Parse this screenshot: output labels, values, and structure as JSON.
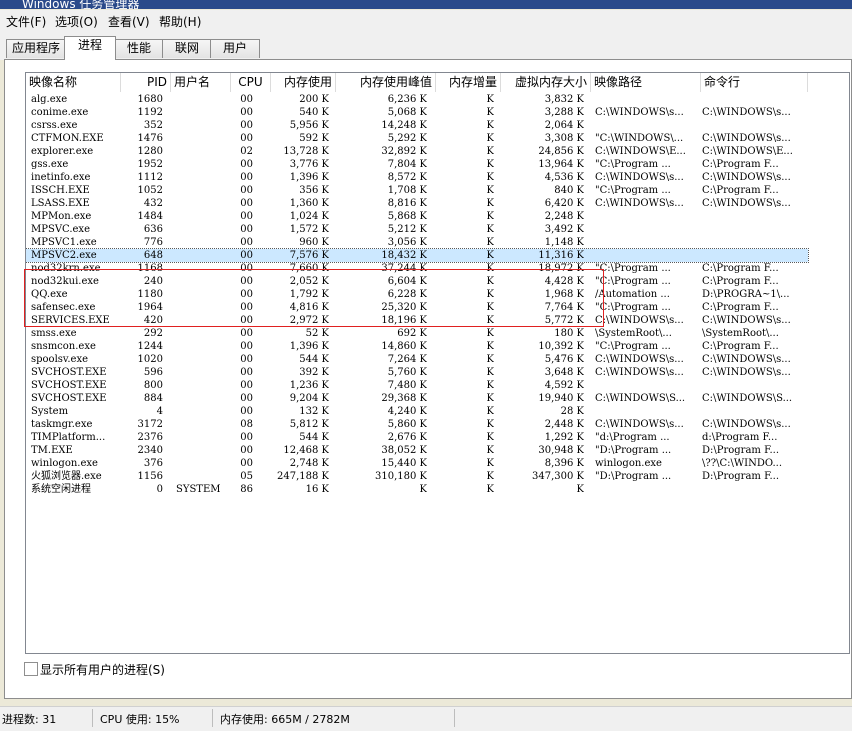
{
  "window": {
    "title": "Windows 任务管理器"
  },
  "menu": [
    {
      "label": "文件(F)"
    },
    {
      "label": "选项(O)"
    },
    {
      "label": "查看(V)"
    },
    {
      "label": "帮助(H)"
    }
  ],
  "tabs": [
    {
      "label": "应用程序",
      "active": false
    },
    {
      "label": "进程",
      "active": true
    },
    {
      "label": "性能",
      "active": false
    },
    {
      "label": "联网",
      "active": false
    },
    {
      "label": "用户",
      "active": false
    }
  ],
  "columns": [
    {
      "key": "name",
      "label": "映像名称"
    },
    {
      "key": "pid",
      "label": "PID"
    },
    {
      "key": "user",
      "label": "用户名"
    },
    {
      "key": "cpu",
      "label": "CPU"
    },
    {
      "key": "mem",
      "label": "内存使用"
    },
    {
      "key": "peak",
      "label": "内存使用峰值"
    },
    {
      "key": "delta",
      "label": "内存增量"
    },
    {
      "key": "vm",
      "label": "虚拟内存大小"
    },
    {
      "key": "path",
      "label": "映像路径"
    },
    {
      "key": "cmd",
      "label": "命令行"
    }
  ],
  "processes": [
    {
      "name": "alg.exe",
      "pid": "1680",
      "user": "",
      "cpu": "00",
      "mem": "200 K",
      "peak": "6,236 K",
      "delta": "K",
      "vm": "3,832 K",
      "path": "",
      "cmd": ""
    },
    {
      "name": "conime.exe",
      "pid": "1192",
      "user": "",
      "cpu": "00",
      "mem": "540 K",
      "peak": "5,068 K",
      "delta": "K",
      "vm": "3,288 K",
      "path": "C:\\WINDOWS\\s...",
      "cmd": "C:\\WINDOWS\\s..."
    },
    {
      "name": "csrss.exe",
      "pid": "352",
      "user": "",
      "cpu": "00",
      "mem": "5,956 K",
      "peak": "14,248 K",
      "delta": "K",
      "vm": "2,064 K",
      "path": "",
      "cmd": ""
    },
    {
      "name": "CTFMON.EXE",
      "pid": "1476",
      "user": "",
      "cpu": "00",
      "mem": "592 K",
      "peak": "5,292 K",
      "delta": "K",
      "vm": "3,308 K",
      "path": "\"C:\\WINDOWS\\...",
      "cmd": "C:\\WINDOWS\\s..."
    },
    {
      "name": "explorer.exe",
      "pid": "1280",
      "user": "",
      "cpu": "02",
      "mem": "13,728 K",
      "peak": "32,892 K",
      "delta": "K",
      "vm": "24,856 K",
      "path": "C:\\WINDOWS\\E...",
      "cmd": "C:\\WINDOWS\\E..."
    },
    {
      "name": "gss.exe",
      "pid": "1952",
      "user": "",
      "cpu": "00",
      "mem": "3,776 K",
      "peak": "7,804 K",
      "delta": "K",
      "vm": "13,964 K",
      "path": "\"C:\\Program ...",
      "cmd": "C:\\Program F..."
    },
    {
      "name": "inetinfo.exe",
      "pid": "1112",
      "user": "",
      "cpu": "00",
      "mem": "1,396 K",
      "peak": "8,572 K",
      "delta": "K",
      "vm": "4,536 K",
      "path": "C:\\WINDOWS\\s...",
      "cmd": "C:\\WINDOWS\\s..."
    },
    {
      "name": "ISSCH.EXE",
      "pid": "1052",
      "user": "",
      "cpu": "00",
      "mem": "356 K",
      "peak": "1,708 K",
      "delta": "K",
      "vm": "840 K",
      "path": "\"C:\\Program ...",
      "cmd": "C:\\Program F..."
    },
    {
      "name": "LSASS.EXE",
      "pid": "432",
      "user": "",
      "cpu": "00",
      "mem": "1,360 K",
      "peak": "8,816 K",
      "delta": "K",
      "vm": "6,420 K",
      "path": "C:\\WINDOWS\\s...",
      "cmd": "C:\\WINDOWS\\s..."
    },
    {
      "name": "MPMon.exe",
      "pid": "1484",
      "user": "",
      "cpu": "00",
      "mem": "1,024 K",
      "peak": "5,868 K",
      "delta": "K",
      "vm": "2,248 K",
      "path": "",
      "cmd": ""
    },
    {
      "name": "MPSVC.exe",
      "pid": "636",
      "user": "",
      "cpu": "00",
      "mem": "1,572 K",
      "peak": "5,212 K",
      "delta": "K",
      "vm": "3,492 K",
      "path": "",
      "cmd": ""
    },
    {
      "name": "MPSVC1.exe",
      "pid": "776",
      "user": "",
      "cpu": "00",
      "mem": "960 K",
      "peak": "3,056 K",
      "delta": "K",
      "vm": "1,148 K",
      "path": "",
      "cmd": ""
    },
    {
      "name": "MPSVC2.exe",
      "pid": "648",
      "user": "",
      "cpu": "00",
      "mem": "7,576 K",
      "peak": "18,432 K",
      "delta": "K",
      "vm": "11,316 K",
      "path": "",
      "cmd": "",
      "selected": true
    },
    {
      "name": "nod32krn.exe",
      "pid": "1168",
      "user": "",
      "cpu": "00",
      "mem": "7,660 K",
      "peak": "37,244 K",
      "delta": "K",
      "vm": "18,972 K",
      "path": "\"C:\\Program ...",
      "cmd": "C:\\Program F..."
    },
    {
      "name": "nod32kui.exe",
      "pid": "240",
      "user": "",
      "cpu": "00",
      "mem": "2,052 K",
      "peak": "6,604 K",
      "delta": "K",
      "vm": "4,428 K",
      "path": "\"C:\\Program ...",
      "cmd": "C:\\Program F..."
    },
    {
      "name": "QQ.exe",
      "pid": "1180",
      "user": "",
      "cpu": "00",
      "mem": "1,792 K",
      "peak": "6,228 K",
      "delta": "K",
      "vm": "1,968 K",
      "path": "/Automation ...",
      "cmd": "D:\\PROGRA~1\\..."
    },
    {
      "name": "safensec.exe",
      "pid": "1964",
      "user": "",
      "cpu": "00",
      "mem": "4,816 K",
      "peak": "25,320 K",
      "delta": "K",
      "vm": "7,764 K",
      "path": "\"C:\\Program ...",
      "cmd": "C:\\Program F..."
    },
    {
      "name": "SERVICES.EXE",
      "pid": "420",
      "user": "",
      "cpu": "00",
      "mem": "2,972 K",
      "peak": "18,196 K",
      "delta": "K",
      "vm": "5,772 K",
      "path": "C:\\WINDOWS\\s...",
      "cmd": "C:\\WINDOWS\\s..."
    },
    {
      "name": "smss.exe",
      "pid": "292",
      "user": "",
      "cpu": "00",
      "mem": "52 K",
      "peak": "692 K",
      "delta": "K",
      "vm": "180 K",
      "path": "\\SystemRoot\\...",
      "cmd": "\\SystemRoot\\..."
    },
    {
      "name": "snsmcon.exe",
      "pid": "1244",
      "user": "",
      "cpu": "00",
      "mem": "1,396 K",
      "peak": "14,860 K",
      "delta": "K",
      "vm": "10,392 K",
      "path": "\"C:\\Program ...",
      "cmd": "C:\\Program F..."
    },
    {
      "name": "spoolsv.exe",
      "pid": "1020",
      "user": "",
      "cpu": "00",
      "mem": "544 K",
      "peak": "7,264 K",
      "delta": "K",
      "vm": "5,476 K",
      "path": "C:\\WINDOWS\\s...",
      "cmd": "C:\\WINDOWS\\s..."
    },
    {
      "name": "SVCHOST.EXE",
      "pid": "596",
      "user": "",
      "cpu": "00",
      "mem": "392 K",
      "peak": "5,760 K",
      "delta": "K",
      "vm": "3,648 K",
      "path": "C:\\WINDOWS\\s...",
      "cmd": "C:\\WINDOWS\\s..."
    },
    {
      "name": "SVCHOST.EXE",
      "pid": "800",
      "user": "",
      "cpu": "00",
      "mem": "1,236 K",
      "peak": "7,480 K",
      "delta": "K",
      "vm": "4,592 K",
      "path": "",
      "cmd": ""
    },
    {
      "name": "SVCHOST.EXE",
      "pid": "884",
      "user": "",
      "cpu": "00",
      "mem": "9,204 K",
      "peak": "29,368 K",
      "delta": "K",
      "vm": "19,940 K",
      "path": "C:\\WINDOWS\\S...",
      "cmd": "C:\\WINDOWS\\S..."
    },
    {
      "name": "System",
      "pid": "4",
      "user": "",
      "cpu": "00",
      "mem": "132 K",
      "peak": "4,240 K",
      "delta": "K",
      "vm": "28 K",
      "path": "",
      "cmd": ""
    },
    {
      "name": "taskmgr.exe",
      "pid": "3172",
      "user": "",
      "cpu": "08",
      "mem": "5,812 K",
      "peak": "5,860 K",
      "delta": "K",
      "vm": "2,448 K",
      "path": "C:\\WINDOWS\\s...",
      "cmd": "C:\\WINDOWS\\s..."
    },
    {
      "name": "TIMPlatform...",
      "pid": "2376",
      "user": "",
      "cpu": "00",
      "mem": "544 K",
      "peak": "2,676 K",
      "delta": "K",
      "vm": "1,292 K",
      "path": "\"d:\\Program ...",
      "cmd": "d:\\Program F..."
    },
    {
      "name": "TM.EXE",
      "pid": "2340",
      "user": "",
      "cpu": "00",
      "mem": "12,468 K",
      "peak": "38,052 K",
      "delta": "K",
      "vm": "30,948 K",
      "path": "\"D:\\Program ...",
      "cmd": "D:\\Program F..."
    },
    {
      "name": "winlogon.exe",
      "pid": "376",
      "user": "",
      "cpu": "00",
      "mem": "2,748 K",
      "peak": "15,440 K",
      "delta": "K",
      "vm": "8,396 K",
      "path": "winlogon.exe",
      "cmd": "\\??\\C:\\WINDO..."
    },
    {
      "name": "火狐浏览器.exe",
      "pid": "1156",
      "user": "",
      "cpu": "05",
      "mem": "247,188 K",
      "peak": "310,180 K",
      "delta": "K",
      "vm": "347,300 K",
      "path": "\"D:\\Program ...",
      "cmd": "D:\\Program F..."
    },
    {
      "name": "系统空闲进程",
      "pid": "0",
      "user": "SYSTEM",
      "cpu": "86",
      "mem": "16 K",
      "peak": "K",
      "delta": "K",
      "vm": "K",
      "path": "",
      "cmd": ""
    }
  ],
  "show_all_users": {
    "label": "显示所有用户的进程(S)",
    "checked": false
  },
  "status": {
    "process_count": "进程数: 31",
    "cpu_usage": "CPU 使用: 15%",
    "memory": "内存使用: 665M / 2782M"
  },
  "colors": {
    "highlight_box": "#e02020",
    "selection": "#cce8ff"
  }
}
